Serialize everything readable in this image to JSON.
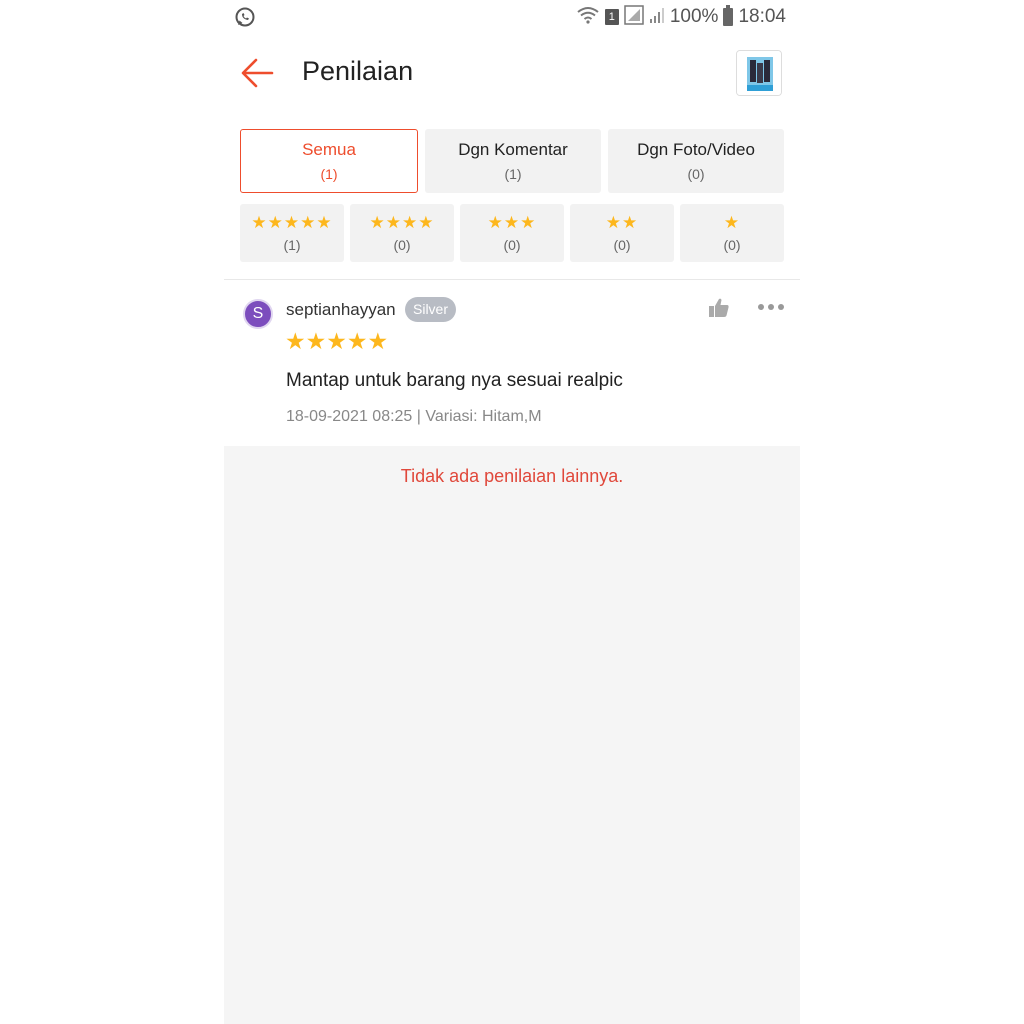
{
  "status_bar": {
    "battery": "100%",
    "time": "18:04",
    "sim_slot": "1",
    "icons": [
      "whatsapp-icon",
      "wifi-icon",
      "sim-icon",
      "signal-icon",
      "battery-icon"
    ]
  },
  "header": {
    "title": "Penilaian",
    "back_icon": "arrow-left-icon",
    "accent_color": "#ee4d2d"
  },
  "filters": {
    "tabs": [
      {
        "label": "Semua",
        "count": "(1)"
      },
      {
        "label": "Dgn Komentar",
        "count": "(1)"
      },
      {
        "label": "Dgn Foto/Video",
        "count": "(0)"
      }
    ],
    "star_tabs": [
      {
        "stars": "★★★★★",
        "count": "(1)"
      },
      {
        "stars": "★★★★",
        "count": "(0)"
      },
      {
        "stars": "★★★",
        "count": "(0)"
      },
      {
        "stars": "★★",
        "count": "(0)"
      },
      {
        "stars": "★",
        "count": "(0)"
      }
    ]
  },
  "review": {
    "avatar_letter": "S",
    "username": "septianhayyan",
    "badge": "Silver",
    "stars": "★★★★★",
    "text": "Mantap untuk barang nya sesuai realpic",
    "meta": "18-09-2021 08:25 | Variasi: Hitam,M"
  },
  "footer": {
    "message": "Tidak ada penilaian lainnya."
  }
}
